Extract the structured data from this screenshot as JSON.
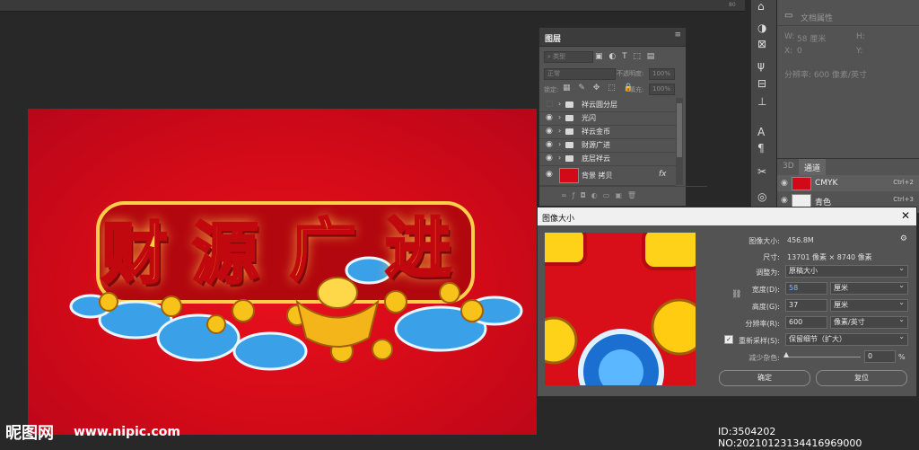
{
  "ruler": {
    "ticks": [
      "",
      "",
      "",
      "",
      "",
      "",
      "",
      "",
      "80"
    ]
  },
  "layers_panel": {
    "tab": "图层",
    "search_placeholder": "类型",
    "blend_mode": "正常",
    "opacity_label": "不透明度:",
    "opacity_value": "100%",
    "lock_label": "锁定:",
    "fill_label": "填充:",
    "fill_value": "100%",
    "layers": [
      {
        "name": "祥云圆分层",
        "visible": false,
        "type": "group"
      },
      {
        "name": "光闪",
        "visible": true,
        "type": "group"
      },
      {
        "name": "祥云金币",
        "visible": true,
        "type": "group"
      },
      {
        "name": "财源广进",
        "visible": true,
        "type": "group"
      },
      {
        "name": "底层祥云",
        "visible": true,
        "type": "group"
      },
      {
        "name": "背景 拷贝",
        "visible": true,
        "type": "layer"
      }
    ],
    "fx": "fx"
  },
  "properties_panel": {
    "title": "文档属性",
    "w_label": "W:",
    "w_value": "58 厘米",
    "h_label": "H:",
    "x_label": "X:",
    "x_value": "0",
    "y_label": "Y:",
    "resolution": "分辨率: 600 像素/英寸"
  },
  "channels_panel": {
    "tabs": [
      "3D",
      "通道"
    ],
    "channels": [
      {
        "name": "CMYK",
        "shortcut": "Ctrl+2"
      },
      {
        "name": "青色",
        "shortcut": "Ctrl+3"
      }
    ]
  },
  "canvas_art": {
    "chars": [
      "财",
      "源",
      "广",
      "进"
    ]
  },
  "image_size_dialog": {
    "title": "图像大小",
    "image_size_label": "图像大小:",
    "image_size_value": "456.8M",
    "dimensions_label": "尺寸:",
    "dimensions_value": "13701 像素 × 8740 像素",
    "fit_label": "调整为:",
    "fit_value": "原稿大小",
    "width_label": "宽度(D):",
    "width_value": "58",
    "width_unit": "厘米",
    "height_label": "高度(G):",
    "height_value": "37",
    "height_unit": "厘米",
    "resolution_label": "分辨率(R):",
    "resolution_value": "600",
    "resolution_unit": "像素/英寸",
    "resample_label": "重新采样(S):",
    "resample_value": "保留细节（扩大）",
    "noise_label": "减少杂色:",
    "noise_value": "0",
    "noise_unit": "%",
    "ok_label": "确定",
    "reset_label": "复位"
  },
  "watermark": {
    "logo": "昵图网",
    "site": "www.nipic.com",
    "id_text": "ID:3504202 NO:20210123134416969000"
  },
  "colors": {
    "canvas_red": "#d20a18",
    "panel": "#535353",
    "gold": "#ffd23a"
  }
}
